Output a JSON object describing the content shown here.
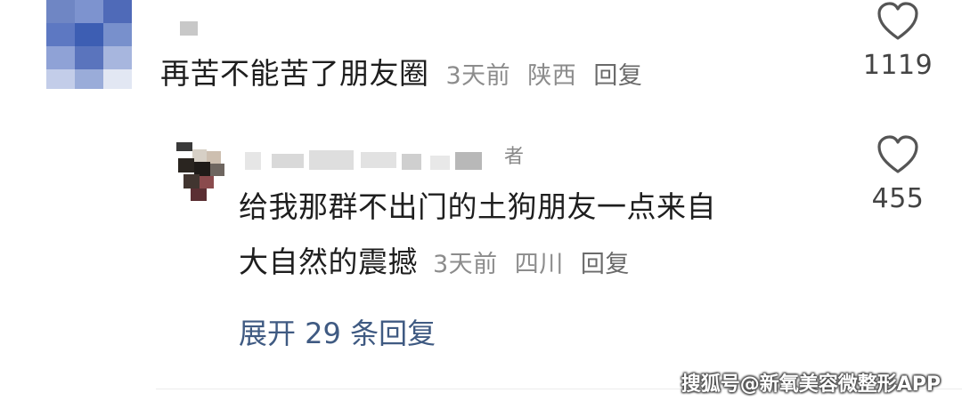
{
  "comments": [
    {
      "text": "再苦不能苦了朋友圈",
      "time": "3天前",
      "location": "陕西",
      "reply_label": "回复",
      "like_count": "1119"
    }
  ],
  "reply": {
    "author_tag": "者",
    "text_line1": "给我那群不出门的土狗朋友一点来自",
    "text_line2": "大自然的震撼",
    "time": "3天前",
    "location": "四川",
    "reply_label": "回复",
    "like_count": "455"
  },
  "expand_replies": "展开 29 条回复",
  "watermark": "搜狐号@新氧美容微整形APP",
  "colors": {
    "link": "#3f5a82",
    "meta": "#8c8c8c",
    "text": "#1e1e1e"
  }
}
